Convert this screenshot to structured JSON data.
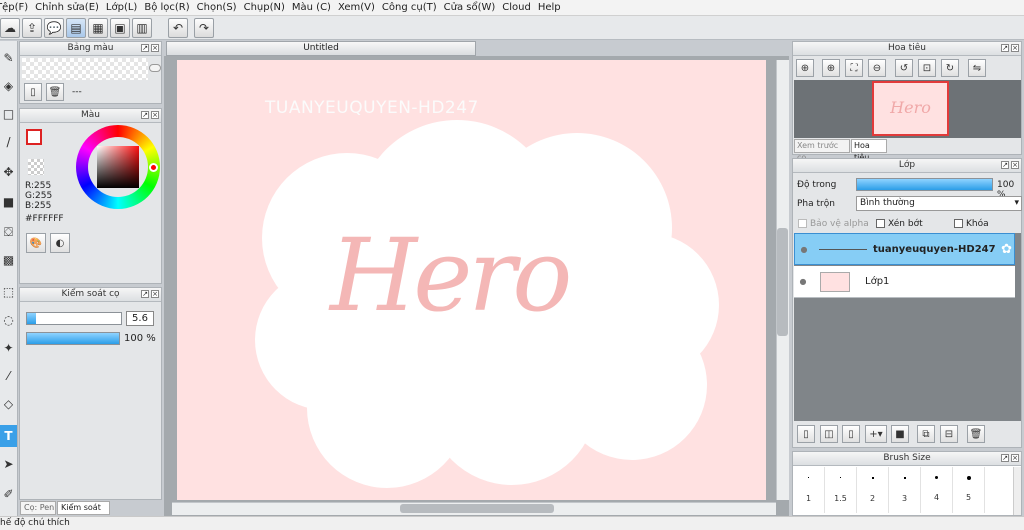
{
  "menu": [
    "Tệp(F)",
    "Chỉnh sửa(E)",
    "Lớp(L)",
    "Bộ lọc(R)",
    "Chọn(S)",
    "Chụp(N)",
    "Màu (C)",
    "Xem(V)",
    "Công cụ(T)",
    "Cửa sổ(W)",
    "Cloud",
    "Help"
  ],
  "document": {
    "tab_title": "Untitled"
  },
  "canvas": {
    "watermark": "TUANYEUQUYEN-HD247",
    "hero_text": "Hero",
    "bg_color": "#ffe1e1"
  },
  "panels": {
    "palette": {
      "title": "Bảng màu",
      "placeholder": "---"
    },
    "color": {
      "title": "Màu",
      "r": "R:255",
      "g": "G:255",
      "b": "B:255",
      "hex": "#FFFFFF"
    },
    "brush_control": {
      "title": "Kiểm soát cọ",
      "size_value": "5.6",
      "size_fraction": 0.1,
      "opacity": "100 %"
    },
    "bottom_tabs": [
      "Cọ: Pen",
      "Kiểm soát cọ"
    ],
    "navigator": {
      "title": "Hoa tiêu",
      "tabs": [
        "Xem trước cọ",
        "Hoa tiêu"
      ],
      "thumb_text": "Hero"
    },
    "layers": {
      "title": "Lớp",
      "opacity_label": "Độ trong",
      "opacity_value": "100 %",
      "blend_label": "Pha trộn",
      "blend_value": "Bình thường",
      "checks": [
        "Bảo vệ alpha",
        "Xén bớt",
        "Khóa"
      ],
      "items": [
        {
          "name": "tuanyeuquyen-HD247",
          "selected": true
        },
        {
          "name": "Lớp1",
          "selected": false
        }
      ]
    },
    "brush_size": {
      "title": "Brush Size",
      "sizes": [
        "1",
        "1.5",
        "2",
        "3",
        "4",
        "5"
      ]
    }
  },
  "status_text": "hế độ chú thích",
  "colors": {
    "accent": "#3aa0e8",
    "selected_layer": "#86cdf5",
    "canvas": "#ffe1e1"
  }
}
